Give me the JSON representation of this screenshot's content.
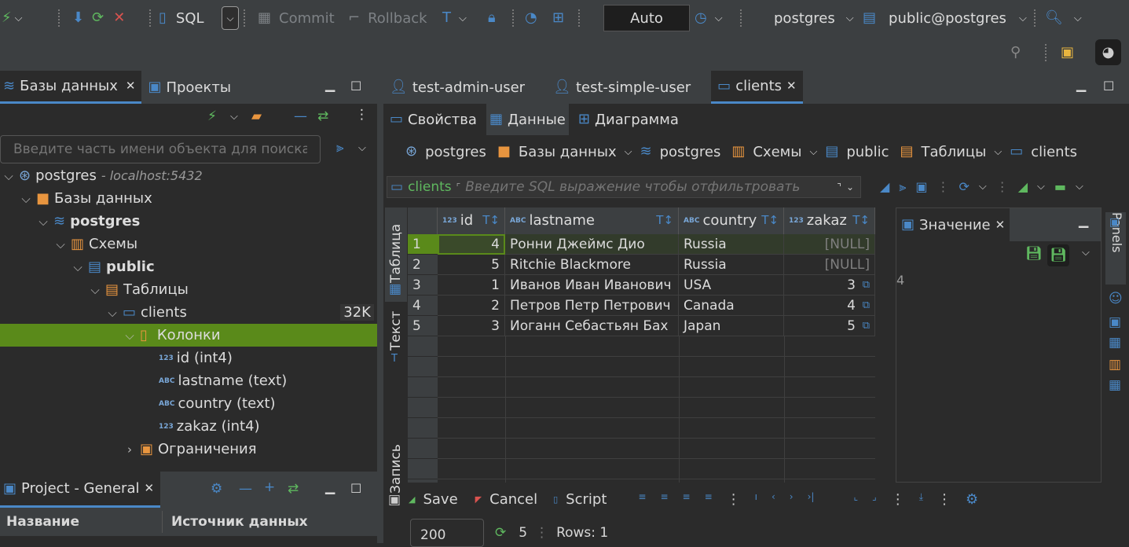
{
  "toolbar": {
    "sql_label": "SQL",
    "commit_label": "Commit",
    "rollback_label": "Rollback",
    "tx_mode": "Auto",
    "connection": "postgres",
    "schema": "public@postgres"
  },
  "left_panel": {
    "tabs": [
      {
        "label": "Базы данных"
      },
      {
        "label": "Проекты"
      }
    ],
    "search_placeholder": "Введите часть имени объекта для поиска",
    "tree": {
      "conn_name": "postgres",
      "conn_host": " - localhost:5432",
      "databases": "Базы данных",
      "db": "postgres",
      "schemas": "Схемы",
      "schema": "public",
      "tables": "Таблицы",
      "table": "clients",
      "table_size": "32K",
      "columns": "Колонки",
      "col1": "id (int4)",
      "col2": "lastname (text)",
      "col3": "country (text)",
      "col4": "zakaz (int4)",
      "constraints": "Ограничения"
    }
  },
  "bottom_panel": {
    "tab": "Project - General",
    "col_name": "Название",
    "col_source": "Источник данных"
  },
  "editor": {
    "tabs": [
      {
        "label": "test-admin-user"
      },
      {
        "label": "test-simple-user"
      },
      {
        "label": "clients"
      }
    ],
    "subtabs": [
      {
        "label": "Свойства"
      },
      {
        "label": "Данные"
      },
      {
        "label": "Диаграмма"
      }
    ],
    "breadcrumb": [
      "postgres",
      "Базы данных",
      "postgres",
      "Схемы",
      "public",
      "Таблицы",
      "clients"
    ],
    "filter_table": "clients",
    "filter_placeholder": "Введите SQL выражение чтобы отфильтровать",
    "side_tabs": {
      "table": "Таблица",
      "text": "Текст",
      "record": "Запись"
    },
    "columns": [
      {
        "type": "123",
        "name": "id"
      },
      {
        "type": "ABC",
        "name": "lastname"
      },
      {
        "type": "ABC",
        "name": "country"
      },
      {
        "type": "123",
        "name": "zakaz"
      }
    ],
    "rows": [
      {
        "n": "1",
        "id": "4",
        "lastname": "Ронни Джеймс Дио",
        "country": "Russia",
        "zakaz": "[NULL]"
      },
      {
        "n": "2",
        "id": "5",
        "lastname": "Ritchie Blackmore",
        "country": "Russia",
        "zakaz": "[NULL]"
      },
      {
        "n": "3",
        "id": "1",
        "lastname": "Иванов Иван Иванович",
        "country": "USA",
        "zakaz": "3"
      },
      {
        "n": "4",
        "id": "2",
        "lastname": "Петров Петр Петрович",
        "country": "Canada",
        "zakaz": "4"
      },
      {
        "n": "5",
        "id": "3",
        "lastname": "Иоганн Себастьян Бах",
        "country": "Japan",
        "zakaz": "5"
      }
    ],
    "value_panel": {
      "title": "Значение",
      "value": "4"
    },
    "panels_label": "Panels",
    "bottom": {
      "save": "Save",
      "cancel": "Cancel",
      "script": "Script",
      "fetch_size": "200",
      "count": "5",
      "rows": "Rows: 1"
    }
  }
}
